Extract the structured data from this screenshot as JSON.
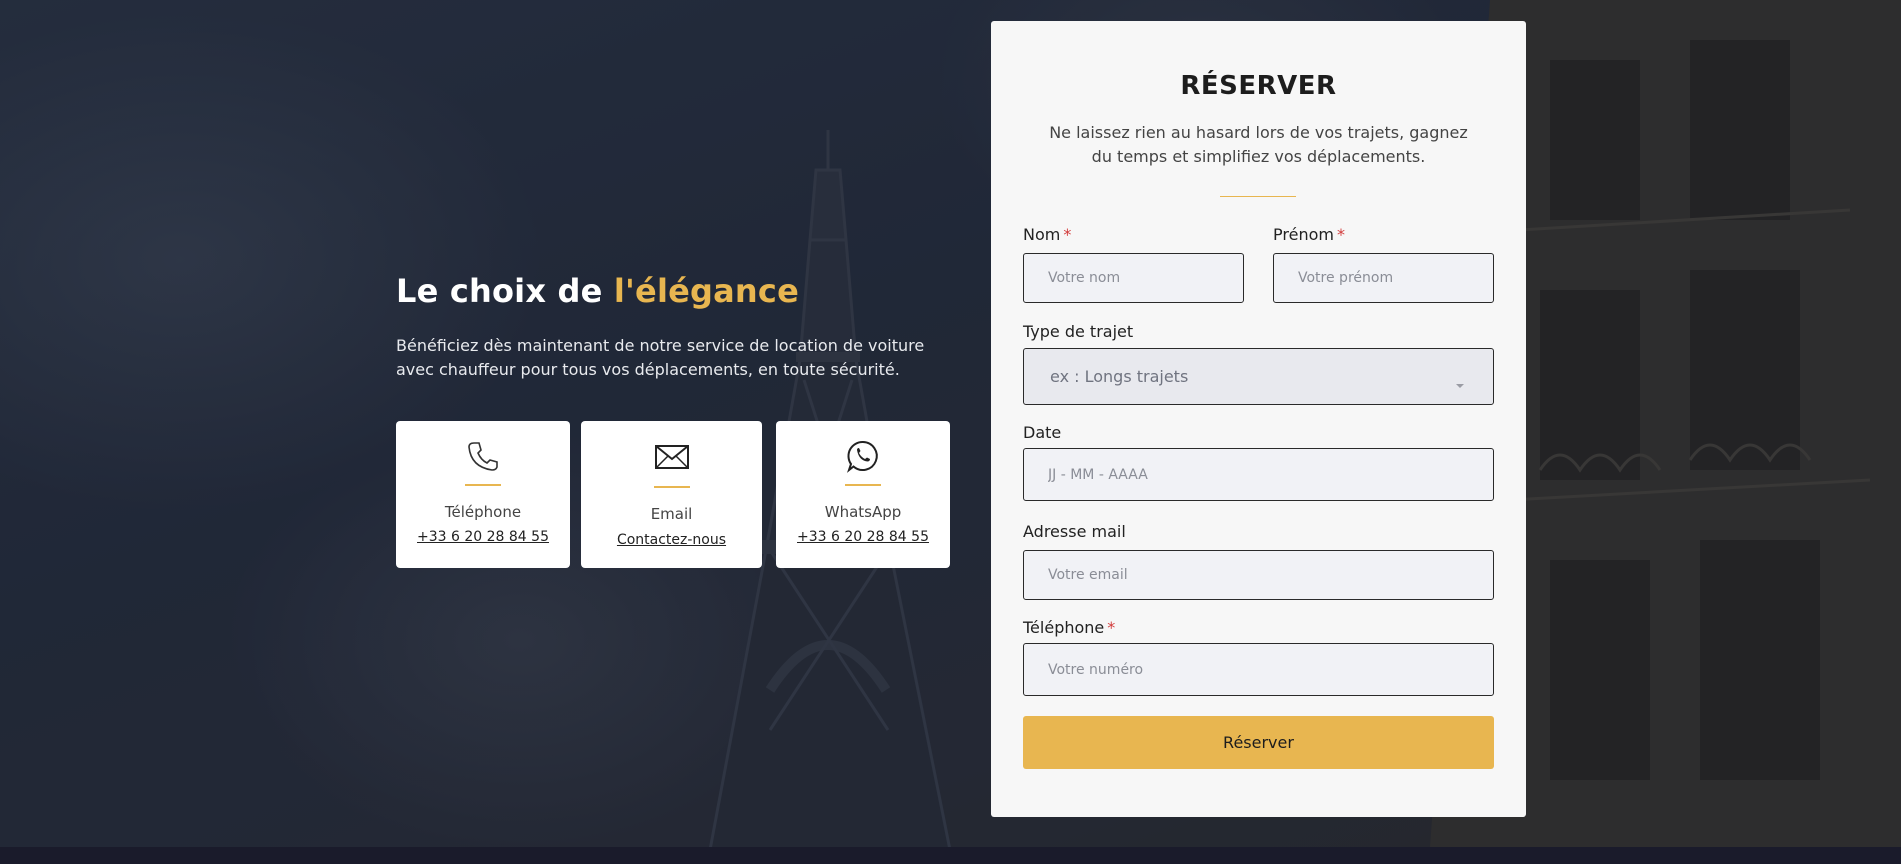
{
  "intro": {
    "title_prefix": "Le choix de ",
    "title_accent": "l'élégance",
    "description": "Bénéficiez dès maintenant de notre service de location de voiture avec chauffeur pour tous vos déplacements, en toute sécurité."
  },
  "contacts": [
    {
      "icon": "phone-icon",
      "label": "Téléphone",
      "value": "+33 6 20 28 84 55"
    },
    {
      "icon": "mail-icon",
      "label": "Email",
      "value": "Contactez-nous"
    },
    {
      "icon": "whatsapp-icon",
      "label": "WhatsApp",
      "value": "+33 6 20 28 84 55"
    }
  ],
  "form": {
    "title": "RÉSERVER",
    "description": "Ne laissez rien au hasard lors de vos trajets, gagnez du temps et simplifiez vos déplacements.",
    "required_mark": "*",
    "nom": {
      "label": "Nom",
      "placeholder": "Votre nom"
    },
    "prenom": {
      "label": "Prénom",
      "placeholder": "Votre prénom"
    },
    "trajet": {
      "label": "Type de trajet",
      "selected": "ex : Longs trajets"
    },
    "date": {
      "label": "Date",
      "placeholder": "JJ - MM - AAAA"
    },
    "email": {
      "label": "Adresse mail",
      "placeholder": "Votre email"
    },
    "telephone": {
      "label": "Téléphone",
      "placeholder": "Votre numéro"
    },
    "submit_label": "Réserver"
  },
  "colors": {
    "accent": "#e8b650",
    "required": "#d23b3b",
    "card_bg": "#ffffff",
    "form_bg": "#f7f7f7"
  }
}
